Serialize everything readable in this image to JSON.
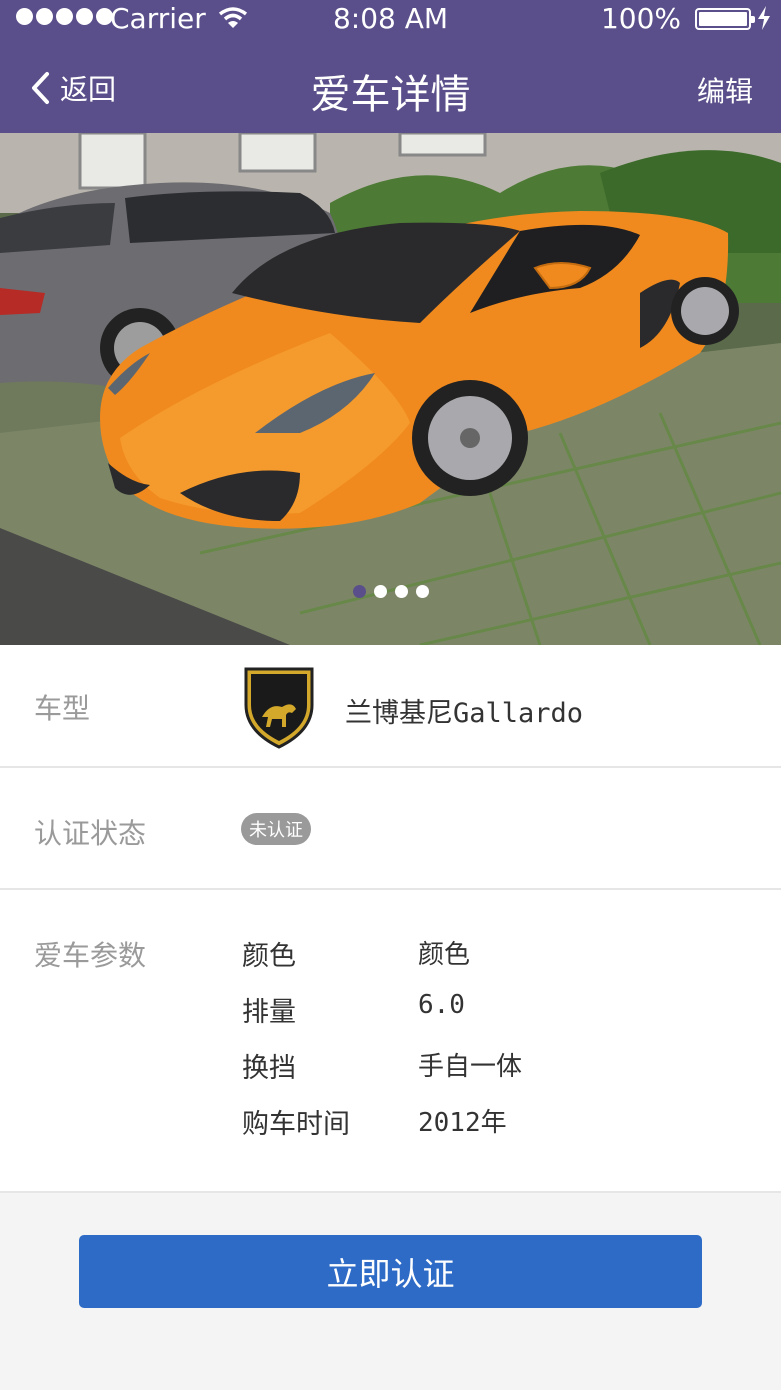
{
  "status_bar": {
    "carrier": "Carrier",
    "time": "8:08 AM",
    "battery": "100%"
  },
  "nav": {
    "back_label": "返回",
    "title": "爱车详情",
    "edit_label": "编辑"
  },
  "gallery": {
    "slide_count": 4,
    "active_index": 0
  },
  "car": {
    "model_label": "车型",
    "model_name": "兰博基尼Gallardo",
    "brand_logo_text": "LAMBORGHINI",
    "cert_label": "认证状态",
    "cert_status": "未认证",
    "params_label": "爱车参数",
    "params": [
      {
        "key": "颜色",
        "value": "颜色"
      },
      {
        "key": "排量",
        "value": "6.0"
      },
      {
        "key": "换挡",
        "value": "手自一体"
      },
      {
        "key": "购车时间",
        "value": "2012年"
      }
    ]
  },
  "actions": {
    "certify_label": "立即认证"
  },
  "colors": {
    "nav_bg": "#5a4f8a",
    "button_bg": "#2d6bc6",
    "car_orange": "#f08a1e"
  }
}
